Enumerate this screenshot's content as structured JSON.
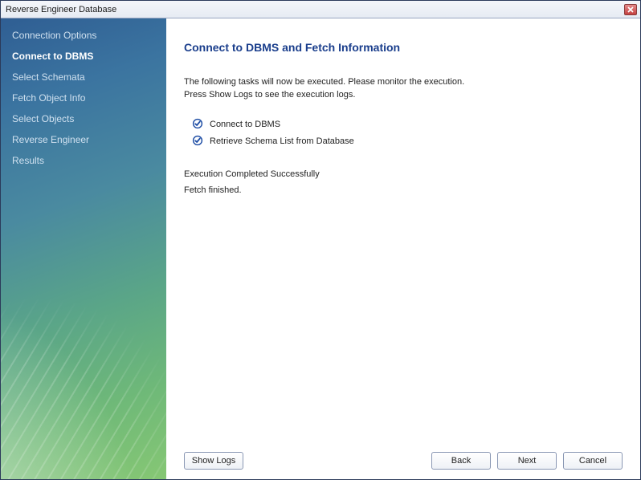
{
  "window": {
    "title": "Reverse Engineer Database"
  },
  "sidebar": {
    "steps": [
      {
        "label": "Connection Options",
        "active": false
      },
      {
        "label": "Connect to DBMS",
        "active": true
      },
      {
        "label": "Select Schemata",
        "active": false
      },
      {
        "label": "Fetch Object Info",
        "active": false
      },
      {
        "label": "Select Objects",
        "active": false
      },
      {
        "label": "Reverse Engineer",
        "active": false
      },
      {
        "label": "Results",
        "active": false
      }
    ]
  },
  "main": {
    "heading": "Connect to DBMS and Fetch Information",
    "intro_line1": "The following tasks will now be executed. Please monitor the execution.",
    "intro_line2": "Press Show Logs to see the execution logs.",
    "tasks": [
      {
        "label": "Connect to DBMS"
      },
      {
        "label": "Retrieve Schema List from Database"
      }
    ],
    "status_line1": "Execution Completed Successfully",
    "status_line2": "Fetch finished."
  },
  "buttons": {
    "show_logs": "Show Logs",
    "back": "Back",
    "next": "Next",
    "cancel": "Cancel"
  },
  "colors": {
    "heading": "#1a3e8c",
    "check": "#1a4aa3"
  }
}
